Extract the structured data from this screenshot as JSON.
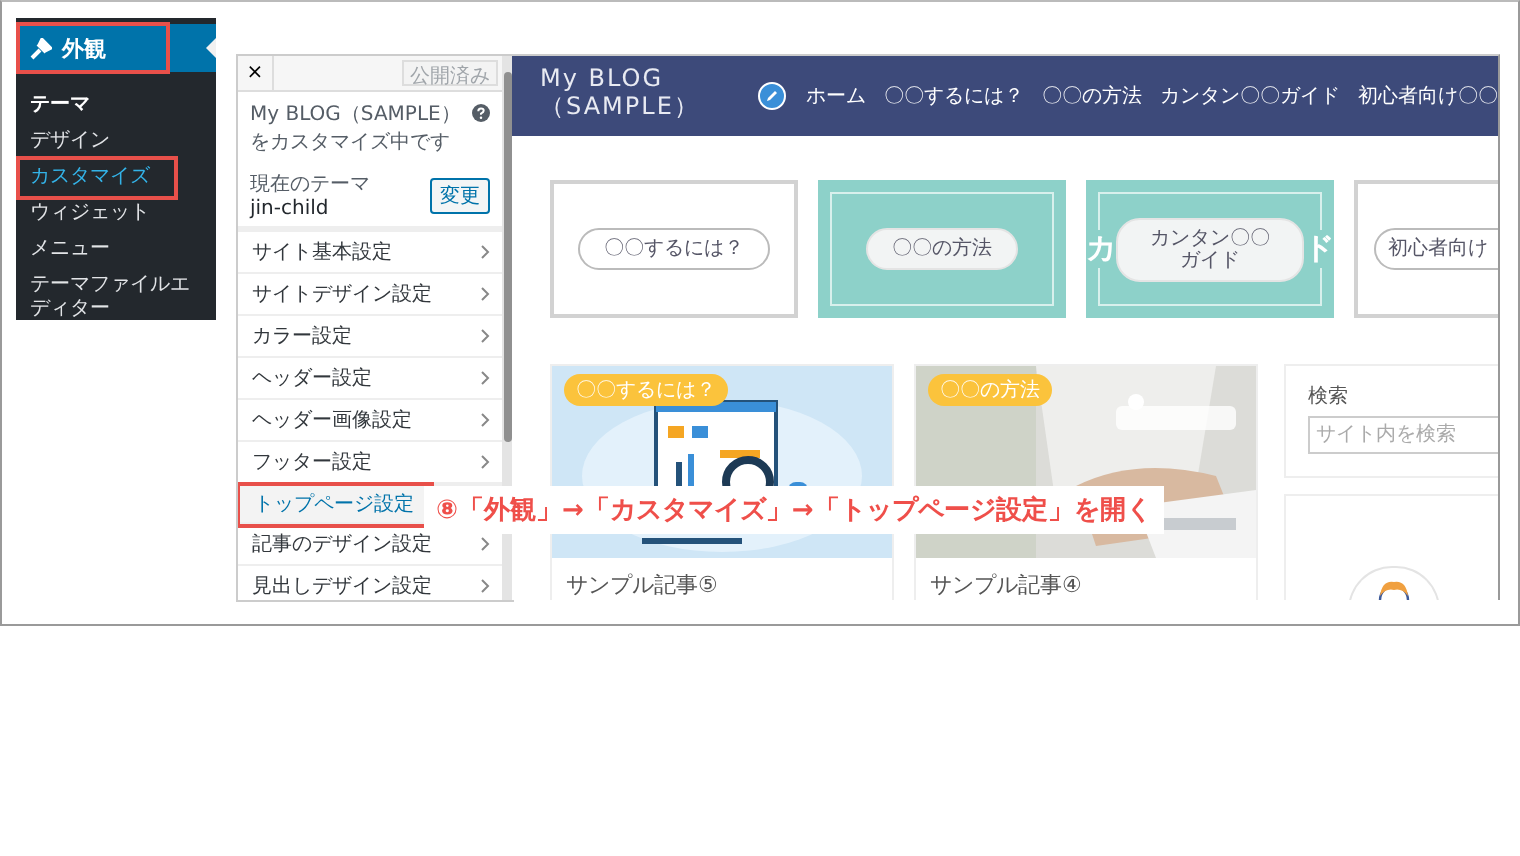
{
  "admin_menu": {
    "header": {
      "label": "外観",
      "highlighted": true
    },
    "items": [
      {
        "label": "テーマ",
        "kind": "current",
        "selected": false,
        "highlighted": false
      },
      {
        "label": "デザイン",
        "kind": "plain",
        "selected": false,
        "highlighted": false
      },
      {
        "label": "カスタマイズ",
        "kind": "plain",
        "selected": true,
        "highlighted": true
      },
      {
        "label": "ウィジェット",
        "kind": "plain",
        "selected": false,
        "highlighted": false
      },
      {
        "label": "メニュー",
        "kind": "plain",
        "selected": false,
        "highlighted": false
      },
      {
        "label": "テーマファイルエディター",
        "kind": "plain",
        "selected": false,
        "highlighted": false
      }
    ]
  },
  "customizer": {
    "close": "×",
    "publish_button": "公開済み",
    "site_title": "My BLOG（SAMPLE）",
    "subtitle": "をカスタマイズ中です",
    "theme_label": "現在のテーマ",
    "theme_name": "jin-child",
    "change_button": "変更",
    "sections": [
      {
        "label": "サイト基本設定",
        "highlighted": false
      },
      {
        "label": "サイトデザイン設定",
        "highlighted": false
      },
      {
        "label": "カラー設定",
        "highlighted": false
      },
      {
        "label": "ヘッダー設定",
        "highlighted": false
      },
      {
        "label": "ヘッダー画像設定",
        "highlighted": false
      },
      {
        "label": "フッター設定",
        "highlighted": false
      },
      {
        "label": "トップページ設定",
        "highlighted": true
      },
      {
        "label": "記事のデザイン設定",
        "highlighted": false
      },
      {
        "label": "見出しデザイン設定",
        "highlighted": false
      }
    ]
  },
  "preview": {
    "site_title": [
      "My BLOG",
      "（SAMPLE）"
    ],
    "nav": [
      "ホーム",
      "〇〇するには？",
      "〇〇の方法",
      "カンタン〇〇ガイド",
      "初心者向け〇〇"
    ],
    "menu_cards": [
      {
        "label": "〇〇するには？",
        "kind": "outline"
      },
      {
        "label": "〇〇の方法",
        "kind": "teal"
      },
      {
        "label": "カンタン〇〇ガイド",
        "kind": "teal",
        "backdrop_left": "カ",
        "backdrop_right": "ド"
      },
      {
        "label": "初心者向け",
        "kind": "outline"
      }
    ],
    "articles": [
      {
        "tag": "〇〇するには？",
        "title": "サンプル記事⑤",
        "kind": "picture"
      },
      {
        "tag": "〇〇の方法",
        "title": "サンプル記事④",
        "kind": "picture"
      }
    ],
    "sidebar": {
      "search_title": "検索",
      "search_placeholder": "サイト内を検索"
    }
  },
  "annotation": "⑧「外観」→「カスタマイズ」→「トップページ設定」を開く"
}
